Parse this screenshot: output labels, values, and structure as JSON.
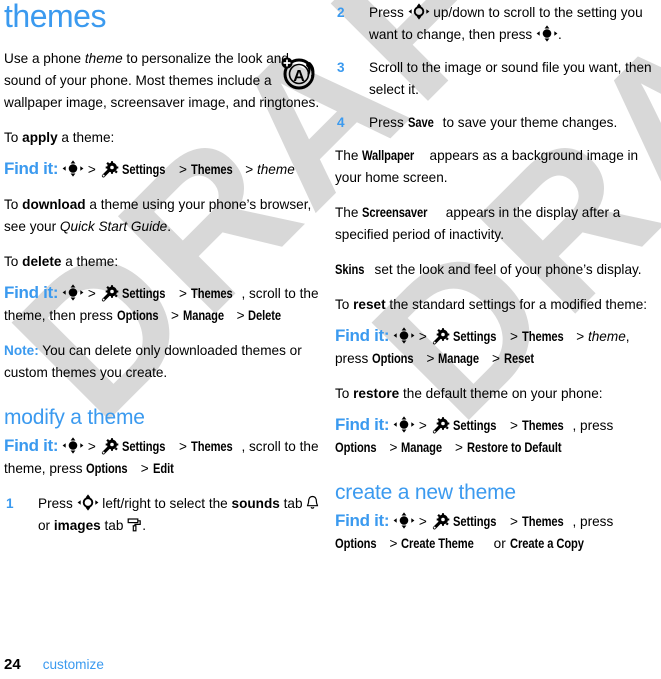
{
  "page": {
    "chapter_title": "themes",
    "footer_page_number": "24",
    "footer_chapter": "customize",
    "watermark_text": "DRAFT",
    "accent_color": "#3b9aef",
    "chapter_icon": "theme-personalize-icon"
  },
  "left": {
    "intro": {
      "t1": "Use a phone ",
      "em1": "theme",
      "t2": " to personalize the look and sound of your phone. Most themes include a wallpaper image, screensaver image, and ringtones."
    },
    "apply_lead": {
      "t1": "To ",
      "b1": "apply",
      "t2": " a theme:"
    },
    "findit_apply": {
      "label": "Find it:",
      "sep1": ">",
      "settings": "Settings",
      "sep2": ">",
      "themes": "Themes",
      "sep3": ">",
      "theme_italic": "theme"
    },
    "download": {
      "t1": "To ",
      "b1": "download",
      "t2": " a theme using your phone’s browser, see your ",
      "em1": "Quick Start Guide",
      "t3": "."
    },
    "delete_lead": {
      "t1": "To ",
      "b1": "delete",
      "t2": " a theme:"
    },
    "findit_delete": {
      "label": "Find it:",
      "sep1": ">",
      "settings": "Settings",
      "sep2": ">",
      "themes": "Themes",
      "tail1": ", scroll to the theme, then press ",
      "options": "Options",
      "sep3": ">",
      "manage": "Manage",
      "sep4": ">",
      "delete": "Delete"
    },
    "note": {
      "label": "Note:",
      "text": " You can delete only downloaded themes or custom themes you create."
    },
    "modify_heading": "modify a theme",
    "findit_modify": {
      "label": "Find it:",
      "sep1": ">",
      "settings": "Settings",
      "sep2": ">",
      "themes": "Themes",
      "tail1": ", scroll to the theme, press ",
      "options": "Options",
      "sep3": ">",
      "edit": "Edit"
    },
    "step1": {
      "num": "1",
      "t1": "Press ",
      "t2": " left/right to select the ",
      "b1": "sounds",
      "t3": " tab ",
      "t4": " or ",
      "b2": "images",
      "t5": " tab ",
      "t6": "."
    }
  },
  "right": {
    "step2": {
      "num": "2",
      "t1": "Press ",
      "t2": " up/down to scroll to the setting you want to change, then press ",
      "t3": "."
    },
    "step3": {
      "num": "3",
      "text": "Scroll to the image or sound file you want, then select it."
    },
    "step4": {
      "num": "4",
      "t1": "Press ",
      "b1": "Save",
      "t2": " to save your theme changes."
    },
    "wallpaper": {
      "t1": "The ",
      "b1": "Wallpaper",
      "t2": " appears as a background image in your home screen."
    },
    "screensaver": {
      "t1": "The ",
      "b1": "Screensaver",
      "t2": " appears in the display after a specified period of inactivity."
    },
    "skins": {
      "b1": "Skins",
      "t2": " set the look and feel of your phone’s display."
    },
    "reset_lead": {
      "t1": "To ",
      "b1": "reset",
      "t2": " the standard settings for a modified theme:"
    },
    "findit_reset": {
      "label": "Find it:",
      "sep1": ">",
      "settings": "Settings",
      "sep2": ">",
      "themes": "Themes",
      "sep3": ">",
      "theme_italic": "theme",
      "tail1": ", press ",
      "options": "Options",
      "sep4": ">",
      "manage": "Manage",
      "sep5": ">",
      "reset": "Reset"
    },
    "restore_lead": {
      "t1": "To ",
      "b1": "restore",
      "t2": " the default theme on your phone:"
    },
    "findit_restore": {
      "label": "Find it:",
      "sep1": ">",
      "settings": "Settings",
      "sep2": ">",
      "themes": "Themes",
      "tail1": ", press ",
      "options": "Options",
      "sep3": ">",
      "manage": "Manage",
      "sep4": ">",
      "restore": "Restore to Default"
    },
    "create_heading": "create a new theme",
    "findit_create": {
      "label": "Find it:",
      "sep1": ">",
      "settings": "Settings",
      "sep2": ">",
      "themes": "Themes",
      "tail1": ", press ",
      "options": "Options",
      "sep3": ">",
      "create_theme": "Create Theme",
      "or": " or ",
      "create_copy": "Create a Copy"
    }
  }
}
